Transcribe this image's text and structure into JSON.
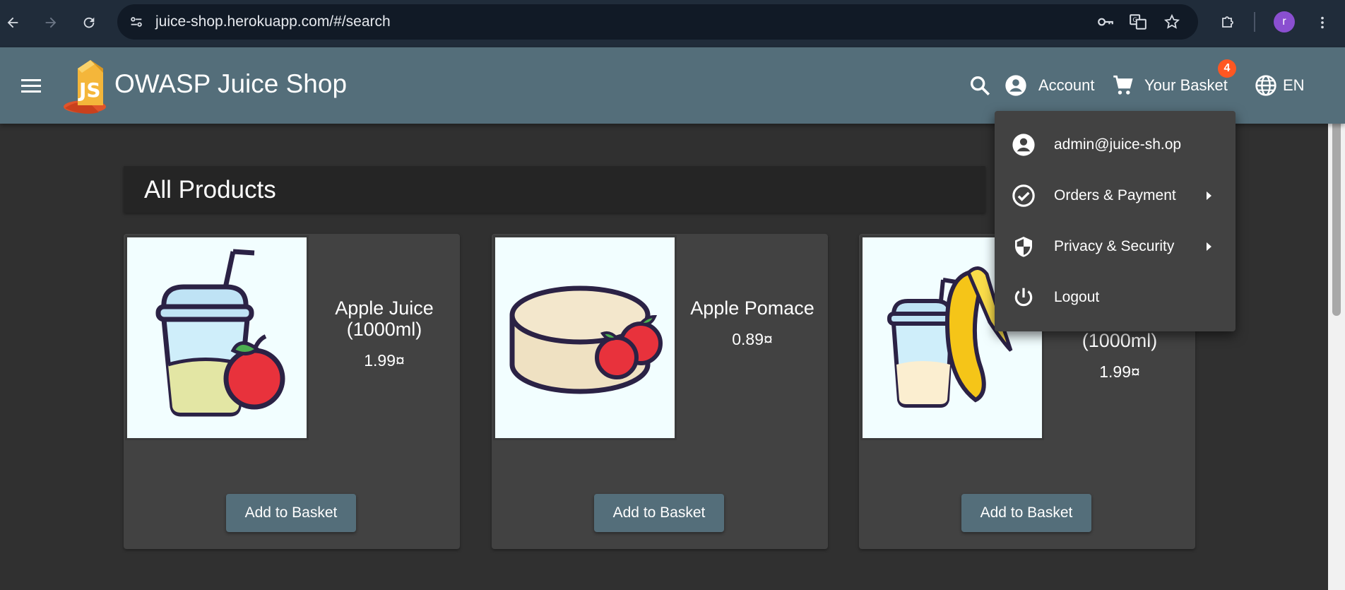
{
  "browser": {
    "url": "juice-shop.herokuapp.com/#/search",
    "profile_initial": "r"
  },
  "toolbar": {
    "app_title": "OWASP Juice Shop",
    "logo_text": "JS",
    "account_label": "Account",
    "basket_label": "Your Basket",
    "basket_count": "4",
    "language": "EN"
  },
  "main": {
    "heading": "All Products",
    "products": [
      {
        "name": "Apple Juice (1000ml)",
        "price": "1.99¤",
        "button": "Add to Basket"
      },
      {
        "name": "Apple Pomace",
        "price": "0.89¤",
        "button": "Add to Basket"
      },
      {
        "name": "(1000ml)",
        "price": "1.99¤",
        "button": "Add to Basket"
      }
    ]
  },
  "account_menu": {
    "items": [
      {
        "label": "admin@juice-sh.op",
        "icon": "account-circle-icon"
      },
      {
        "label": "Orders & Payment",
        "icon": "check-circle-icon"
      },
      {
        "label": "Privacy & Security",
        "icon": "shield-icon"
      },
      {
        "label": "Logout",
        "icon": "power-icon"
      }
    ]
  },
  "colors": {
    "toolbar": "#546e7a",
    "background": "#303030",
    "card": "#424242",
    "badge": "#ff5722"
  }
}
